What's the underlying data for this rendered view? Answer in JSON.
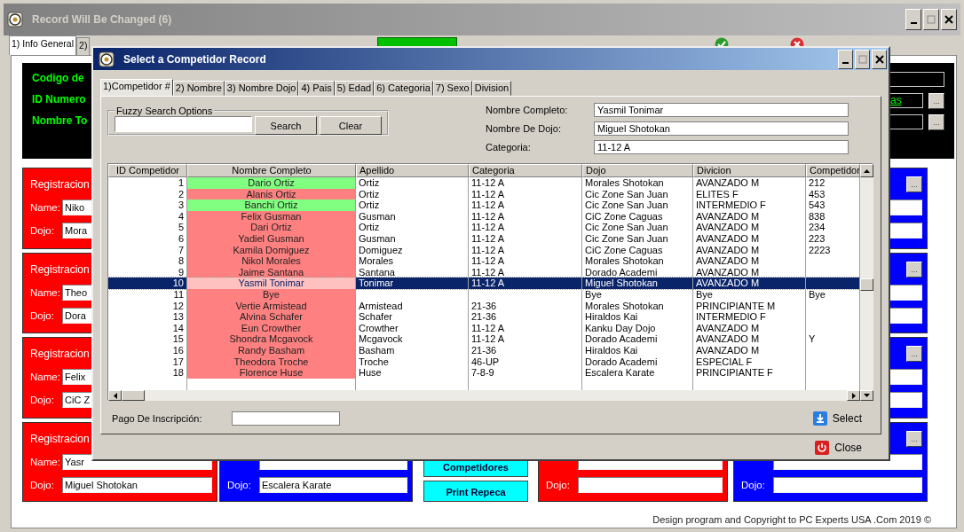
{
  "main_window": {
    "title": "Record Will Be Changed  (6)",
    "tabs": [
      {
        "label": "1) Info General",
        "selected": true
      },
      {
        "label": "2)",
        "selected": false
      }
    ],
    "header_panel": {
      "labels": [
        "Codigo de",
        "ID Numero",
        "Nombre To"
      ],
      "link": "as",
      "menu_buttons": [
        "...",
        "..."
      ]
    },
    "left_cards": [
      {
        "color": "#ff0000",
        "title": "Registracion",
        "name_label": "Name:",
        "name": "Niko",
        "dojo_label": "Dojo:",
        "dojo": "Mora"
      },
      {
        "color": "#ff0000",
        "title": "Registracion",
        "name_label": "Name:",
        "name": "Theo",
        "dojo_label": "Dojo:",
        "dojo": "Dora"
      },
      {
        "color": "#ff0000",
        "title": "Registracion",
        "name_label": "Name:",
        "name": "Felix",
        "dojo_label": "Dojo:",
        "dojo": "CiC Z"
      },
      {
        "color": "#ff0000",
        "title": "Registracion",
        "name_label": "Name:",
        "name": "Yasr",
        "dojo_label": "Dojo:",
        "dojo": "Miguel Shotokan"
      }
    ],
    "bottom_middle": {
      "blue_card": {
        "color": "#0000ff",
        "dojo_label": "Dojo:",
        "dojo": "Escalera Karate"
      },
      "buttons": [
        "Competidores",
        "Print Repeca"
      ],
      "red_card": {
        "color": "#ff0000",
        "dojo_label": "Dojo:"
      }
    },
    "right_cards": [
      {
        "color": "#0000ff",
        "menu_button": "..."
      },
      {
        "color": "#0000ff",
        "menu_button": "..."
      },
      {
        "color": "#0000ff",
        "menu_button": "..."
      },
      {
        "color": "#0000ff",
        "menu_button": "...",
        "dojo_label": "Dojo:"
      }
    ],
    "footer": "Design program and Copyright to PC Experts USA .Com 2019 ©"
  },
  "dialog": {
    "title": "Select a Competidor Record",
    "tabs": [
      {
        "label": "1)Competidor #",
        "selected": true
      },
      {
        "label": "2) Nombre",
        "selected": false
      },
      {
        "label": "3) Nombre Dojo",
        "selected": false
      },
      {
        "label": "4) Pais",
        "selected": false
      },
      {
        "label": "5) Edad",
        "selected": false
      },
      {
        "label": "6) Categoria",
        "selected": false
      },
      {
        "label": "7) Sexo",
        "selected": false
      },
      {
        "label": "Division",
        "selected": false
      }
    ],
    "search": {
      "group_label": "Fuzzy Search Options",
      "search_button": "Search",
      "clear_button": "Clear"
    },
    "details": [
      {
        "label": "Nombre Completo:",
        "value": "Yasmil Tonimar"
      },
      {
        "label": "Nombre De Dojo:",
        "value": "Miguel Shotokan"
      },
      {
        "label": "Categoria:",
        "value": "11-12 A"
      }
    ],
    "table": {
      "columns": [
        "ID Competidor",
        "Nombre Completo",
        "Apellido",
        "Categoria",
        "Dojo",
        "Divicion",
        "Competidor"
      ],
      "rows": [
        {
          "id": "1",
          "name": "Dario Ortiz",
          "color": "#80ff80",
          "apellido": "Ortiz",
          "categoria": "11-12 A",
          "dojo": "Morales Shotokan",
          "divicion": "AVANZADO M",
          "competidor": "212",
          "selected": false
        },
        {
          "id": "2",
          "name": "Alanis Ortiz",
          "color": "#ff8080",
          "apellido": "Ortiz",
          "categoria": "11-12 A",
          "dojo": "Cic Zone San Juan",
          "divicion": "ELITES F",
          "competidor": "453",
          "selected": false
        },
        {
          "id": "3",
          "name": "Banchi Ortiz",
          "color": "#80ff80",
          "apellido": "Ortiz",
          "categoria": "11-12 A",
          "dojo": "Cic Zone San Juan",
          "divicion": "INTERMEDIO F",
          "competidor": "543",
          "selected": false
        },
        {
          "id": "4",
          "name": "Felix Gusman",
          "color": "#ff8080",
          "apellido": "Gusman",
          "categoria": "11-12 A",
          "dojo": "CiC Zone Caguas",
          "divicion": "AVANZADO M",
          "competidor": "838",
          "selected": false
        },
        {
          "id": "5",
          "name": "Dari Ortiz",
          "color": "#ff8080",
          "apellido": "Ortiz",
          "categoria": "11-12 A",
          "dojo": "Cic Zone San Juan",
          "divicion": "AVANZADO M",
          "competidor": "234",
          "selected": false
        },
        {
          "id": "6",
          "name": "Yadiel Gusman",
          "color": "#ff8080",
          "apellido": "Gusman",
          "categoria": "11-12 A",
          "dojo": "Cic Zone San Juan",
          "divicion": "AVANZADO M",
          "competidor": "223",
          "selected": false
        },
        {
          "id": "7",
          "name": "Kamila Domiguez",
          "color": "#ff8080",
          "apellido": "Domiguez",
          "categoria": "11-12 A",
          "dojo": "CiC Zone Caguas",
          "divicion": "AVANZADO M",
          "competidor": "2223",
          "selected": false
        },
        {
          "id": "8",
          "name": "Nikol Morales",
          "color": "#ff8080",
          "apellido": "Morales",
          "categoria": "11-12 A",
          "dojo": "Morales Shotokan",
          "divicion": "AVANZADO M",
          "selected": false
        },
        {
          "id": "9",
          "name": "Jaime Santana",
          "color": "#ff8080",
          "apellido": "Santana",
          "categoria": "11-12 A",
          "dojo": "Dorado Academi",
          "divicion": "AVANZADO M",
          "selected": false
        },
        {
          "id": "10",
          "name": "Yasmil Tonimar",
          "color": "#ffc0c0",
          "apellido": "Tonimar",
          "categoria": "11-12 A",
          "dojo": "Miguel Shotokan",
          "divicion": "AVANZADO M",
          "selected": true
        },
        {
          "id": "11",
          "name": "Bye",
          "color": "#ff8080",
          "dojo": "Bye",
          "divicion": "Bye",
          "competidor": "Bye",
          "selected": false
        },
        {
          "id": "12",
          "name": "Vertie Armistead",
          "color": "#ff8080",
          "apellido": "Armistead",
          "categoria": "21-36",
          "dojo": "Morales Shotokan",
          "divicion": "PRINCIPIANTE M",
          "selected": false
        },
        {
          "id": "13",
          "name": "Alvina Schafer",
          "color": "#ff8080",
          "apellido": "Schafer",
          "categoria": "21-36",
          "dojo": "Hiraldos Kai",
          "divicion": "INTERMEDIO F",
          "selected": false
        },
        {
          "id": "14",
          "name": "Eun Crowther",
          "color": "#ff8080",
          "apellido": "Crowther",
          "categoria": "11-12 A",
          "dojo": "Kanku Day Dojo",
          "divicion": "AVANZADO M",
          "selected": false
        },
        {
          "id": "15",
          "name": "Shondra Mcgavock",
          "color": "#ff8080",
          "apellido": "Mcgavock",
          "categoria": "11-12 A",
          "dojo": "Dorado Academi",
          "divicion": "AVANZADO M",
          "competidor": "Y",
          "selected": false
        },
        {
          "id": "16",
          "name": "Randy Basham",
          "color": "#ff8080",
          "apellido": "Basham",
          "categoria": "21-36",
          "dojo": "Hiraldos Kai",
          "divicion": "AVANZADO M",
          "selected": false
        },
        {
          "id": "17",
          "name": "Theodora Troche",
          "color": "#ff8080",
          "apellido": "Troche",
          "categoria": "46-UP",
          "dojo": "Dorado Academi",
          "divicion": "ESPECIAL F",
          "selected": false
        },
        {
          "id": "18",
          "name": "Florence Huse",
          "color": "#ff8080",
          "apellido": "Huse",
          "categoria": "7-8-9",
          "dojo": "Escalera Karate",
          "divicion": "PRINCIPIANTE F",
          "selected": false
        }
      ]
    },
    "payment": {
      "label": "Pago De Inscripción:"
    },
    "select_button": "Select",
    "close_button": "Close"
  }
}
